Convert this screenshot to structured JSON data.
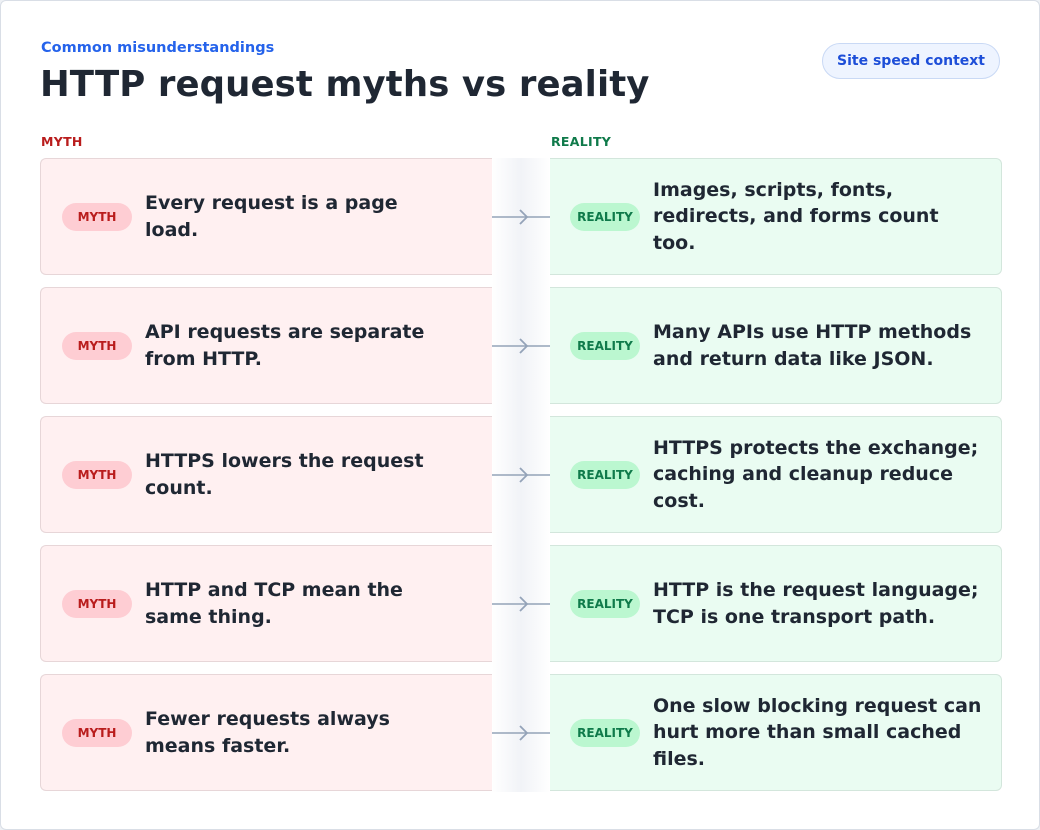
{
  "header": {
    "eyebrow": "Common misunderstandings",
    "title": "HTTP request myths vs reality",
    "context_button": "Site speed context"
  },
  "columns": {
    "myth": "MYTH",
    "reality": "REALITY"
  },
  "pill_labels": {
    "myth": "MYTH",
    "reality": "REALITY"
  },
  "rows": [
    {
      "myth": "Every request is a page load.",
      "reality": "Images, scripts, fonts, redirects, and forms count too."
    },
    {
      "myth": "API requests are separate from HTTP.",
      "reality": "Many APIs use HTTP methods and return data like JSON."
    },
    {
      "myth": "HTTPS lowers the request count.",
      "reality": "HTTPS protects the exchange; caching and cleanup reduce cost."
    },
    {
      "myth": "HTTP and TCP mean the same thing.",
      "reality": "HTTP is the request language; TCP is one transport path."
    },
    {
      "myth": "Fewer requests always means faster.",
      "reality": "One slow blocking request can hurt more than small cached files."
    }
  ],
  "colors": {
    "accent": "#2563eb",
    "myth": "#b91c1c",
    "reality": "#0f7a4a",
    "arrow": "#94a3b8"
  },
  "icons": {
    "connector": "arrow-right-icon"
  }
}
